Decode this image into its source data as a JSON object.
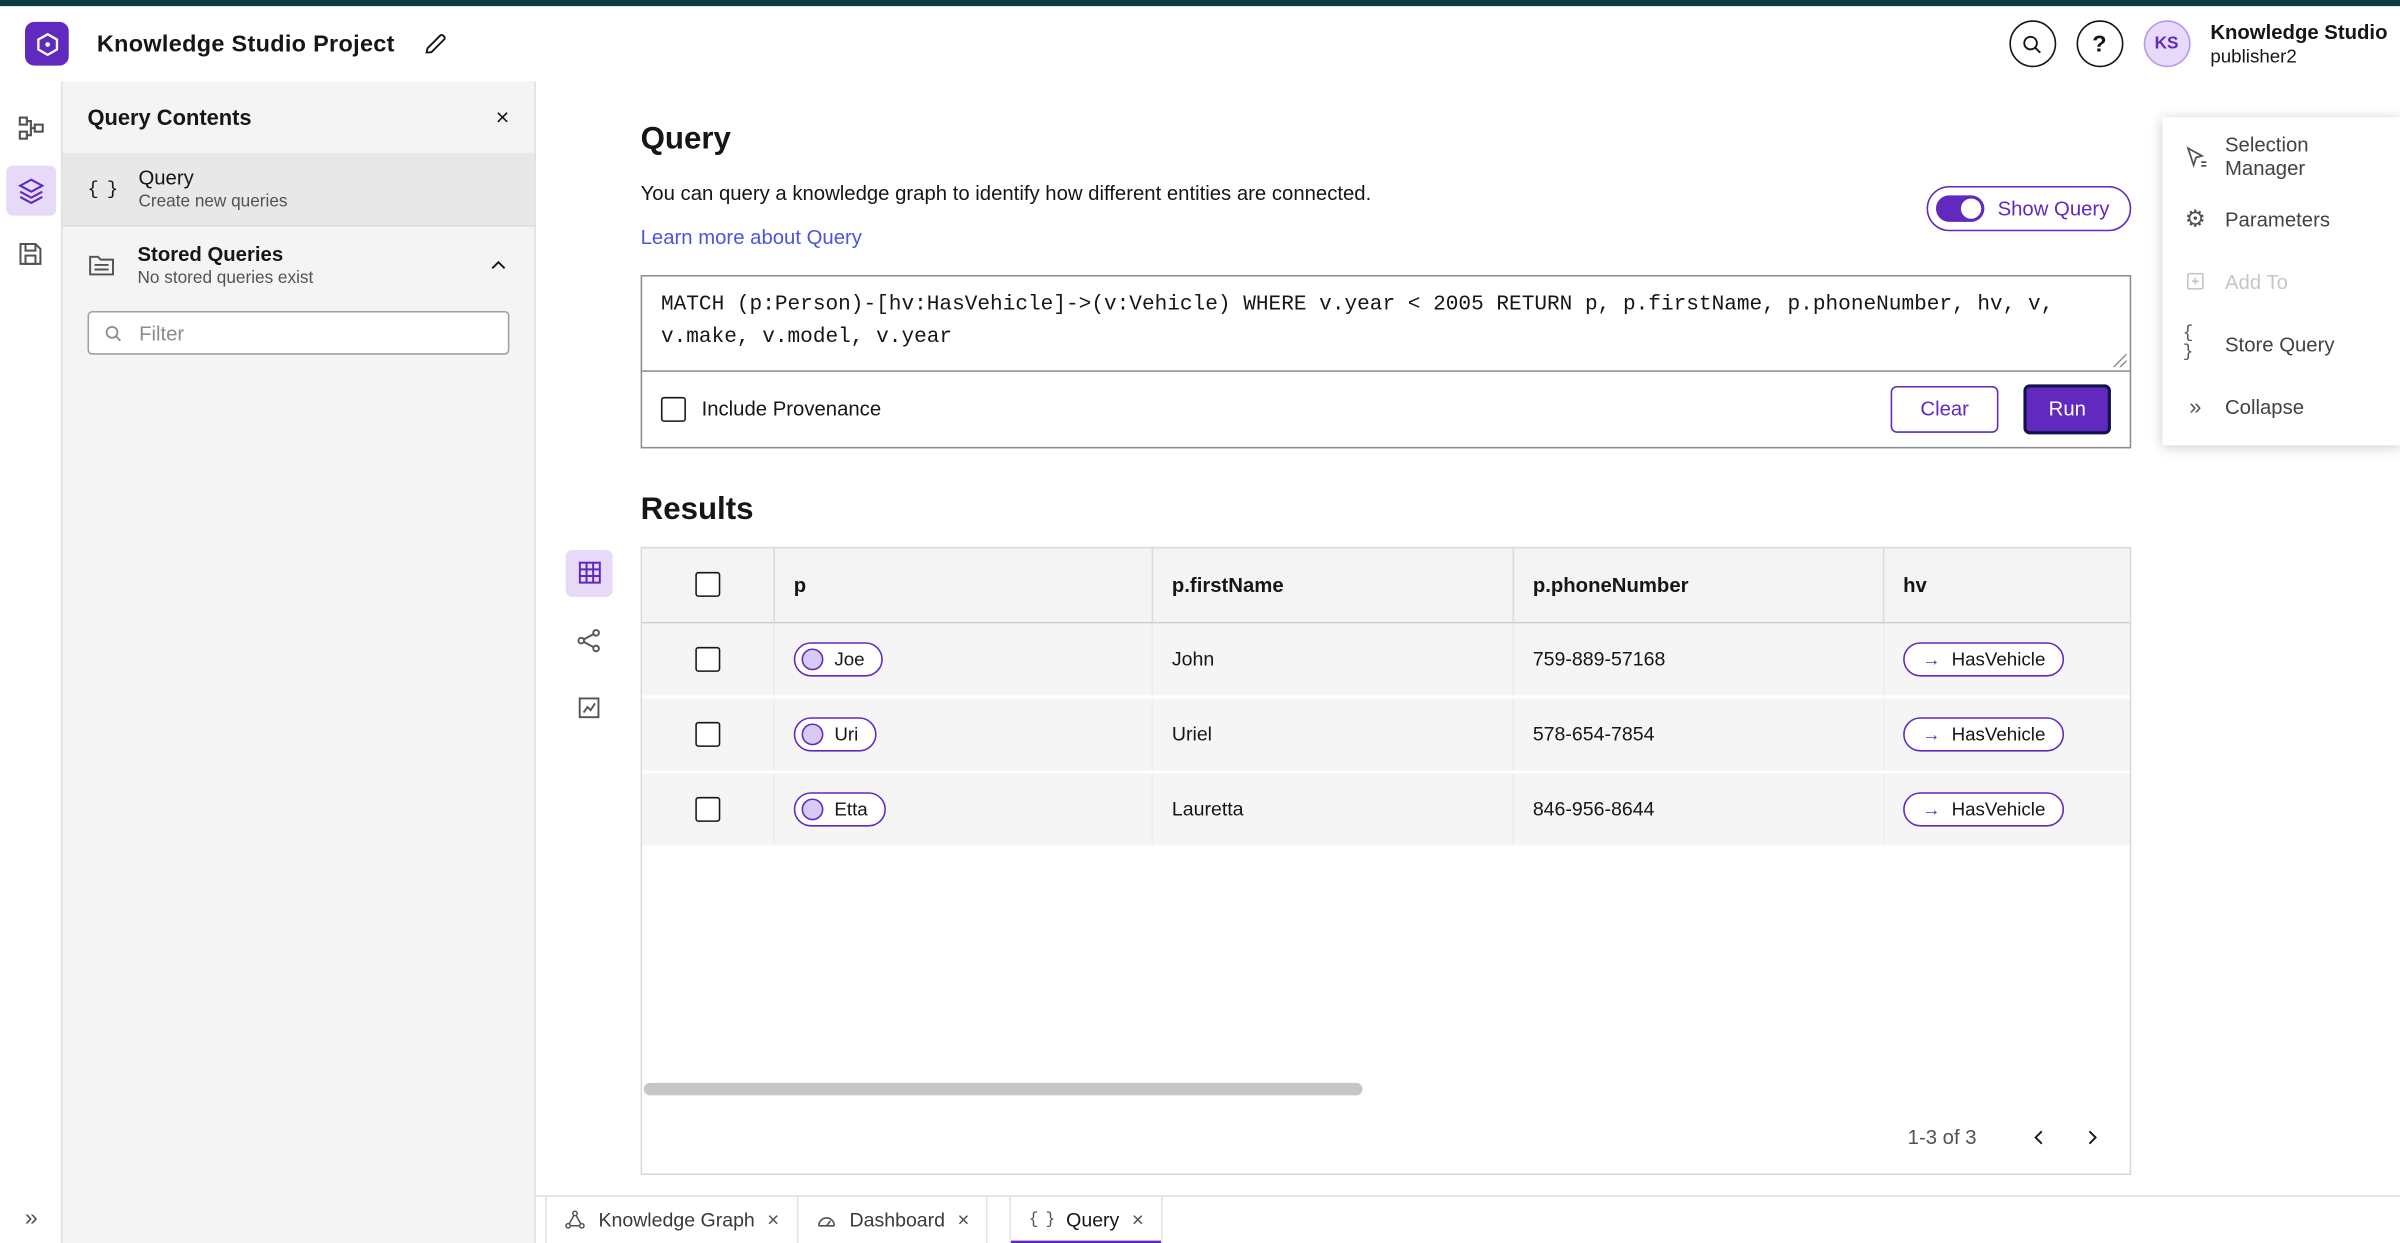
{
  "colors": {
    "accent": "#6129BD",
    "accent_light": "#E6DAF8",
    "link": "#4A54DF",
    "top_strip": "#0B3B40",
    "run_focus_border": "#11144B",
    "panel_bg": "#F4F4F4"
  },
  "header": {
    "title": "Knowledge Studio Project",
    "avatar": "KS",
    "user_name": "Knowledge Studio",
    "user_role": "publisher2"
  },
  "sidebar": {
    "panel_title": "Query Contents",
    "query_item": {
      "label": "Query",
      "sublabel": "Create new queries"
    },
    "stored_queries": {
      "label": "Stored Queries",
      "sublabel": "No stored queries exist"
    },
    "filter_placeholder": "Filter"
  },
  "query": {
    "heading": "Query",
    "description": "You can query a knowledge graph to identify how different entities are connected.",
    "learn_more": "Learn more about Query",
    "show_query_label": "Show Query",
    "code": "MATCH (p:Person)-[hv:HasVehicle]->(v:Vehicle) WHERE v.year < 2005 RETURN p, p.firstName, p.phoneNumber, hv, v, v.make, v.model, v.year",
    "include_provenance_label": "Include Provenance",
    "clear_label": "Clear",
    "run_label": "Run"
  },
  "results": {
    "heading": "Results",
    "columns": [
      "p",
      "p.firstName",
      "p.phoneNumber",
      "hv"
    ],
    "rows": [
      {
        "p": "Joe",
        "firstName": "John",
        "phoneNumber": "759-889-57168",
        "hv": "HasVehicle"
      },
      {
        "p": "Uri",
        "firstName": "Uriel",
        "phoneNumber": "578-654-7854",
        "hv": "HasVehicle"
      },
      {
        "p": "Etta",
        "firstName": "Lauretta",
        "phoneNumber": "846-956-8644",
        "hv": "HasVehicle"
      }
    ],
    "pagination": "1-3 of 3"
  },
  "right_panel": {
    "items": [
      {
        "label": "Selection Manager"
      },
      {
        "label": "Parameters"
      },
      {
        "label": "Add To"
      },
      {
        "label": "Store Query"
      },
      {
        "label": "Collapse"
      }
    ]
  },
  "tabs": [
    {
      "label": "Knowledge Graph"
    },
    {
      "label": "Dashboard"
    },
    {
      "label": "Query"
    }
  ]
}
